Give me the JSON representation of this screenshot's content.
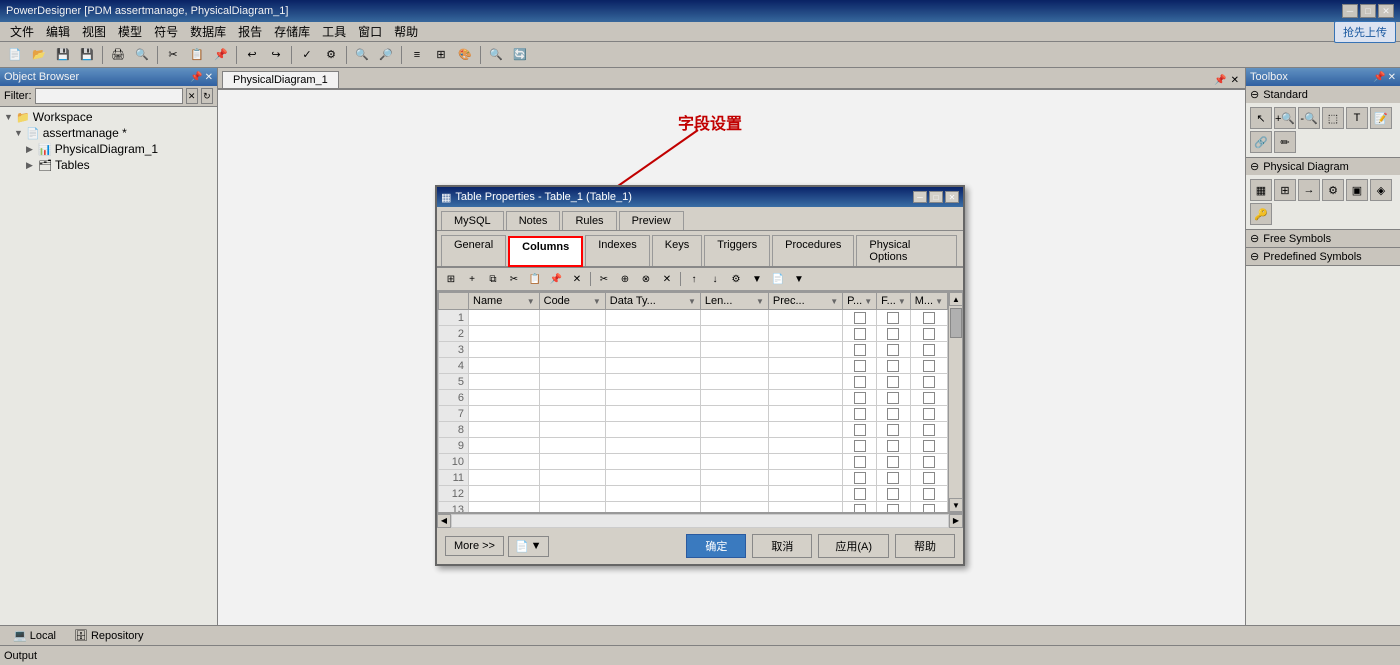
{
  "app": {
    "title": "PowerDesigner [PDM assertmanage, PhysicalDiagram_1]",
    "upload_btn": "抢先上传"
  },
  "menu": {
    "items": [
      "文件",
      "编辑",
      "视图",
      "模型",
      "符号",
      "数据库",
      "报告",
      "存储库",
      "工具",
      "窗口",
      "帮助"
    ]
  },
  "object_browser": {
    "title": "Object Browser",
    "filter_placeholder": "",
    "tree": [
      {
        "label": "Workspace",
        "level": 0,
        "icon": "📁",
        "expanded": true
      },
      {
        "label": "assertmanage *",
        "level": 1,
        "icon": "📄",
        "expanded": true
      },
      {
        "label": "PhysicalDiagram_1",
        "level": 2,
        "icon": "📊",
        "expanded": false
      },
      {
        "label": "Tables",
        "level": 2,
        "icon": "🗂",
        "expanded": false
      }
    ]
  },
  "canvas": {
    "tab": "PhysicalDiagram_1"
  },
  "toolbox": {
    "title": "Toolbox",
    "sections": [
      {
        "name": "Standard",
        "items": [
          "↖",
          "🔍",
          "🔎",
          "↗",
          "📄",
          "💬",
          "🔗",
          "🖊"
        ]
      },
      {
        "name": "Physical Diagram",
        "items": [
          "📋",
          "🔷",
          "➡",
          "⚙",
          "▣",
          "◈",
          "🔑"
        ]
      },
      {
        "name": "Free Symbols",
        "items": []
      },
      {
        "name": "Predefined Symbols",
        "items": []
      }
    ]
  },
  "annotation": {
    "text": "字段设置"
  },
  "modal": {
    "title": "Table Properties - Table_1 (Table_1)",
    "tabs_row1": [
      "MySQL",
      "Notes",
      "Rules",
      "Preview"
    ],
    "tabs_row2": [
      "General",
      "Columns",
      "Indexes",
      "Keys",
      "Triggers",
      "Procedures",
      "Physical Options"
    ],
    "active_tab": "Columns",
    "columns_headers": [
      "",
      "Name",
      "Code",
      "Data Ty...",
      "Len...",
      "Prec...",
      "P...",
      "F...",
      "M..."
    ],
    "rows": 16,
    "footer": {
      "more_btn": "More >>",
      "confirm_btn": "确定",
      "cancel_btn": "取消",
      "apply_btn": "应用(A)",
      "help_btn": "帮助"
    }
  },
  "bottom_tabs": [
    {
      "label": "Local",
      "icon": "💻"
    },
    {
      "label": "Repository",
      "icon": "🗄"
    }
  ],
  "status": {
    "text": "Output"
  }
}
